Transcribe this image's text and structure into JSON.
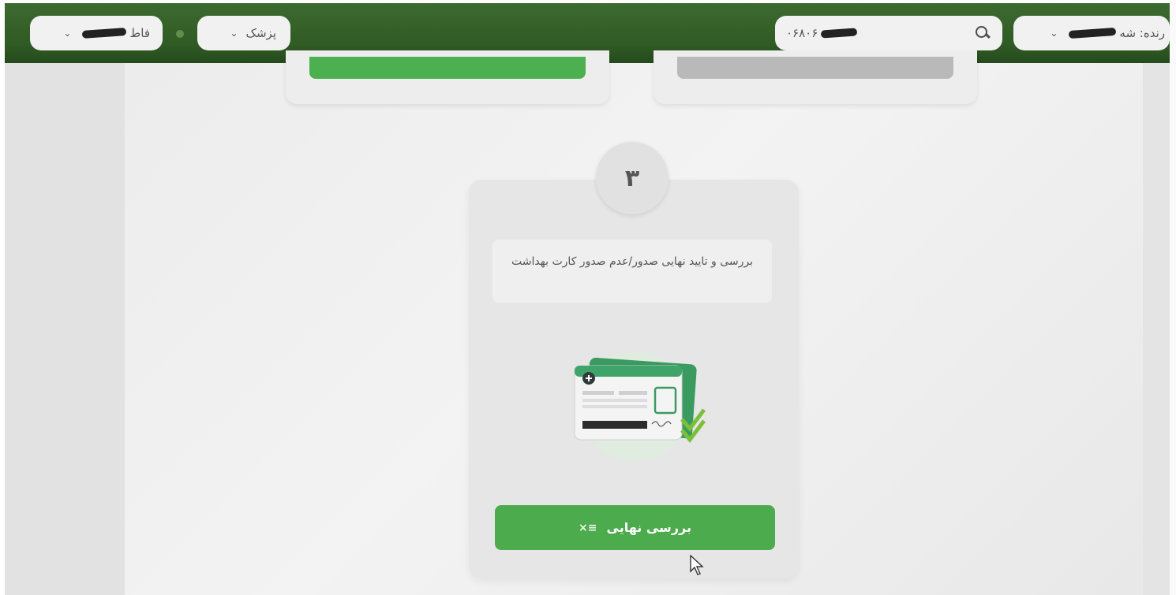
{
  "topbar": {
    "facility_label": "فاط",
    "role_label": "پزشک",
    "search_value": "۰۶۸۰۶",
    "provider_prefix": "رنده: شه"
  },
  "step": {
    "number": "۳",
    "description": "بررسی و تایید نهایی صدور/عدم صدور کارت بهداشت",
    "button_label": "بررسی نهایی"
  },
  "colors": {
    "brand_green": "#4cab4c",
    "topbar_green": "#2f5b24"
  },
  "icons": {
    "search": "search-icon",
    "dropdown": "chevron-down-icon",
    "health_card": "health-card-illustration",
    "button_icon": "list-check-icon"
  }
}
